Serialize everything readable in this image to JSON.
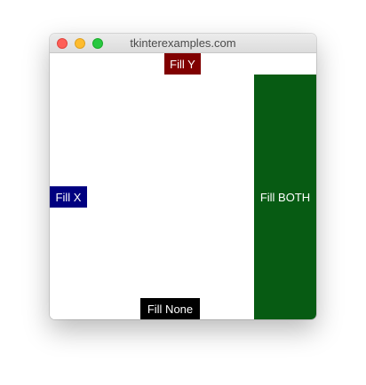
{
  "window": {
    "title": "tkinterexamples.com"
  },
  "labels": {
    "fill_y": {
      "text": "Fill Y",
      "bg": "#800000"
    },
    "fill_x": {
      "text": "Fill X",
      "bg": "#000080"
    },
    "fill_both": {
      "text": "Fill BOTH",
      "bg": "#075b13"
    },
    "fill_none": {
      "text": "Fill None",
      "bg": "#000000"
    }
  },
  "colors": {
    "label_text": "#ffffff",
    "content_bg": "#ffffff"
  }
}
